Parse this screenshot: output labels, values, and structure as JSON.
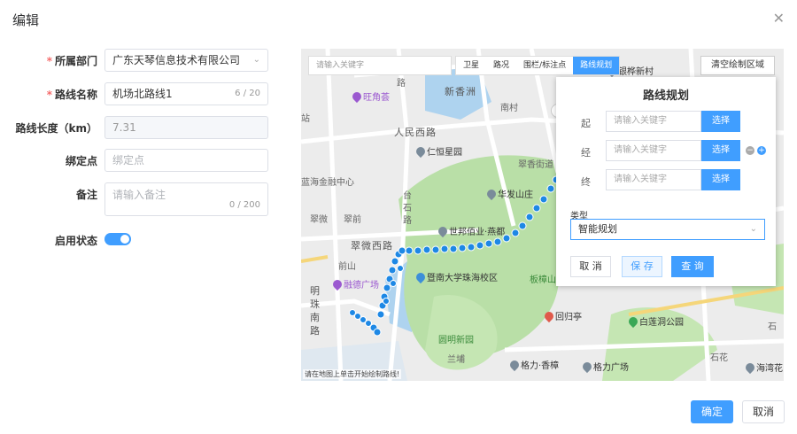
{
  "dialog": {
    "title": "编辑"
  },
  "form": {
    "dept": {
      "label": "所属部门",
      "value": "广东天琴信息技术有限公司"
    },
    "route_name": {
      "label": "路线名称",
      "value": "机场北路线1",
      "count": "6 / 20"
    },
    "length": {
      "label": "路线长度（km）",
      "value": "7.31"
    },
    "bind_point": {
      "label": "绑定点",
      "placeholder": "绑定点"
    },
    "remark": {
      "label": "备注",
      "placeholder": "请输入备注",
      "count": "0 / 200"
    },
    "status": {
      "label": "启用状态",
      "enabled": true
    }
  },
  "map": {
    "search_placeholder": "请输入关键字",
    "tabs": [
      {
        "label": "卫星",
        "active": false
      },
      {
        "label": "路况",
        "active": false
      },
      {
        "label": "围栏/标注点",
        "active": false
      },
      {
        "label": "路线规划",
        "active": true
      }
    ],
    "clear_label": "清空绘制区域",
    "footer_hint": "请在地图上单击开始绘制路线!",
    "labels": {
      "l1": "旺角荟",
      "l2": "新香洲",
      "l3": "南村",
      "l4": "银桦新村",
      "l5": "人民西路",
      "l6": "仁恒星园",
      "l7": "翠香街道",
      "l8": "华发山庄",
      "l9": "台",
      "l10": "石",
      "l11": "路",
      "l12": "世邦佰业·燕都",
      "l13": "翠前",
      "l14": "翠微",
      "l15": "翠微西路",
      "l16": "前山",
      "l17": "暨南大学珠海校区",
      "l18": "融德广场",
      "l19": "明",
      "l20": "珠",
      "l21": "南",
      "l22": "路",
      "l23": "板樟山",
      "l24": "回归亭",
      "l25": "白莲洞公园",
      "l26": "圆明新园",
      "l27": "兰埔",
      "l28": "格力·香樟",
      "l29": "格力广场",
      "l30": "石花",
      "l31": "海湾花",
      "l32": "蓝海金融中心",
      "l33": "站",
      "l34": "路",
      "l35": "石"
    }
  },
  "route_panel": {
    "title": "路线规划",
    "start": {
      "label": "起",
      "placeholder": "请输入关键字",
      "btn": "选择"
    },
    "via": {
      "label": "经",
      "placeholder": "请输入关键字",
      "btn": "选择"
    },
    "end": {
      "label": "终",
      "placeholder": "请输入关键字",
      "btn": "选择"
    },
    "type_label": "类型",
    "type_value": "智能规划",
    "cancel": "取 消",
    "save": "保 存",
    "query": "查 询"
  },
  "footer": {
    "ok": "确定",
    "cancel": "取消"
  },
  "colors": {
    "primary": "#409eff",
    "route": "#1e88e5",
    "park": "#b9dfa7",
    "water": "#aed3ef"
  }
}
